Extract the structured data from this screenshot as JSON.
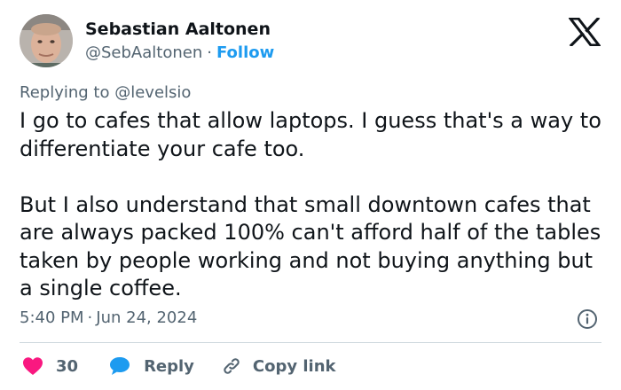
{
  "author": {
    "name": "Sebastian Aaltonen",
    "handle": "@SebAaltonen",
    "separator": "·",
    "follow_label": "Follow"
  },
  "reply_context": {
    "prefix": "Replying to",
    "mention": "@levelsio"
  },
  "tweet": {
    "paragraphs": [
      "I go to cafes that allow laptops. I guess that's a way to differentiate your cafe too.",
      "But I also understand that small downtown cafes that are always packed 100% can't afford half of the tables taken by people working and not buying anything but a single coffee."
    ],
    "time": "5:40 PM",
    "separator": "·",
    "date": "Jun 24, 2024"
  },
  "actions": {
    "likes_count": "30",
    "reply_label": "Reply",
    "copy_link_label": "Copy link"
  },
  "icons": {
    "brand": "x-logo-icon",
    "info": "info-icon",
    "like": "heart-icon",
    "reply": "speech-bubble-icon",
    "copy": "link-icon"
  },
  "colors": {
    "text_primary": "#0f1419",
    "text_secondary": "#536471",
    "accent": "#1d9bf0",
    "like": "#f91880",
    "divider": "#cfd9de"
  }
}
